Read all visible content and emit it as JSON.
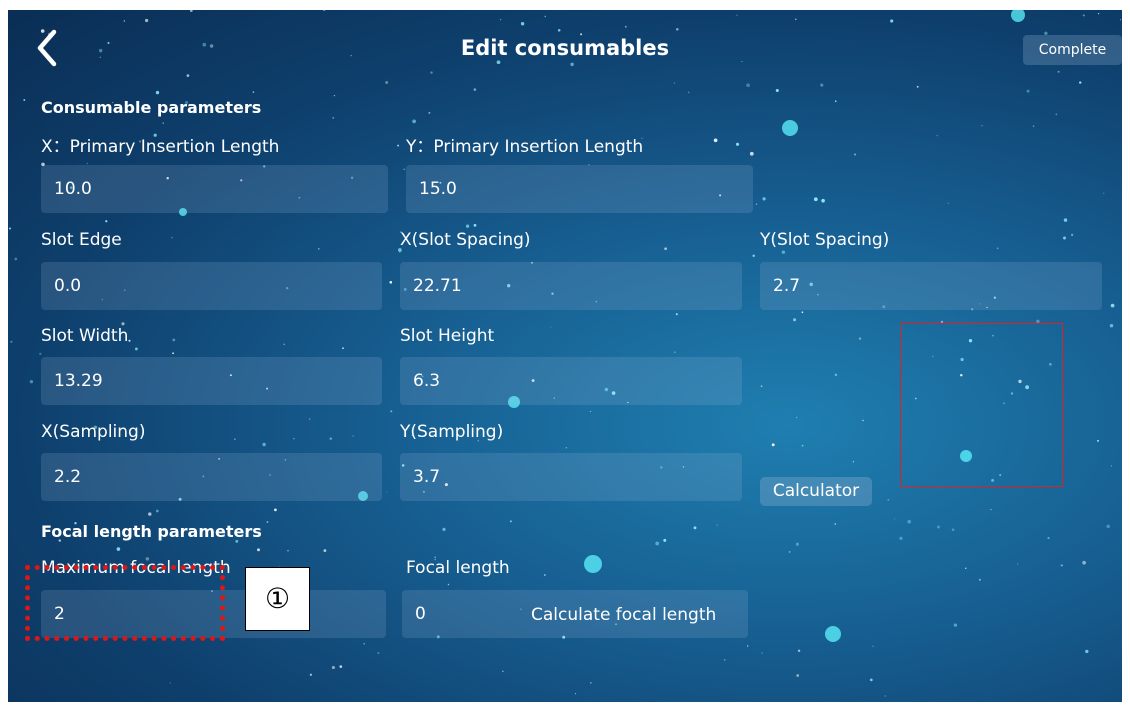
{
  "header": {
    "title": "Edit consumables",
    "complete_label": "Complete"
  },
  "sections": {
    "consumable": "Consumable parameters",
    "focal": "Focal length parameters"
  },
  "fields": {
    "x_primary": {
      "label": "X：Primary Insertion Length",
      "value": "10.0"
    },
    "y_primary": {
      "label": "Y：Primary Insertion Length",
      "value": "15.0"
    },
    "slot_edge": {
      "label": "Slot Edge",
      "value": "0.0"
    },
    "x_slot_spacing": {
      "label": "X(Slot Spacing)",
      "value": "22.71"
    },
    "y_slot_spacing": {
      "label": "Y(Slot Spacing)",
      "value": "2.7"
    },
    "slot_width": {
      "label": "Slot Width",
      "value": "13.29"
    },
    "slot_height": {
      "label": "Slot Height",
      "value": "6.3"
    },
    "x_sampling": {
      "label": "X(Sampling)",
      "value": "2.2"
    },
    "y_sampling": {
      "label": "Y(Sampling)",
      "value": "3.7"
    },
    "max_focal": {
      "label": "Maximum focal length",
      "value": "2"
    },
    "focal": {
      "label": "Focal length",
      "value": "0"
    }
  },
  "buttons": {
    "calculator": "Calculator",
    "calculate_focal": "Calculate focal length"
  },
  "annotation": {
    "marker": "①"
  },
  "icons": {
    "back": "chevron-left-icon"
  },
  "colors": {
    "background": "#175f92",
    "annotation_red": "#e01515"
  }
}
